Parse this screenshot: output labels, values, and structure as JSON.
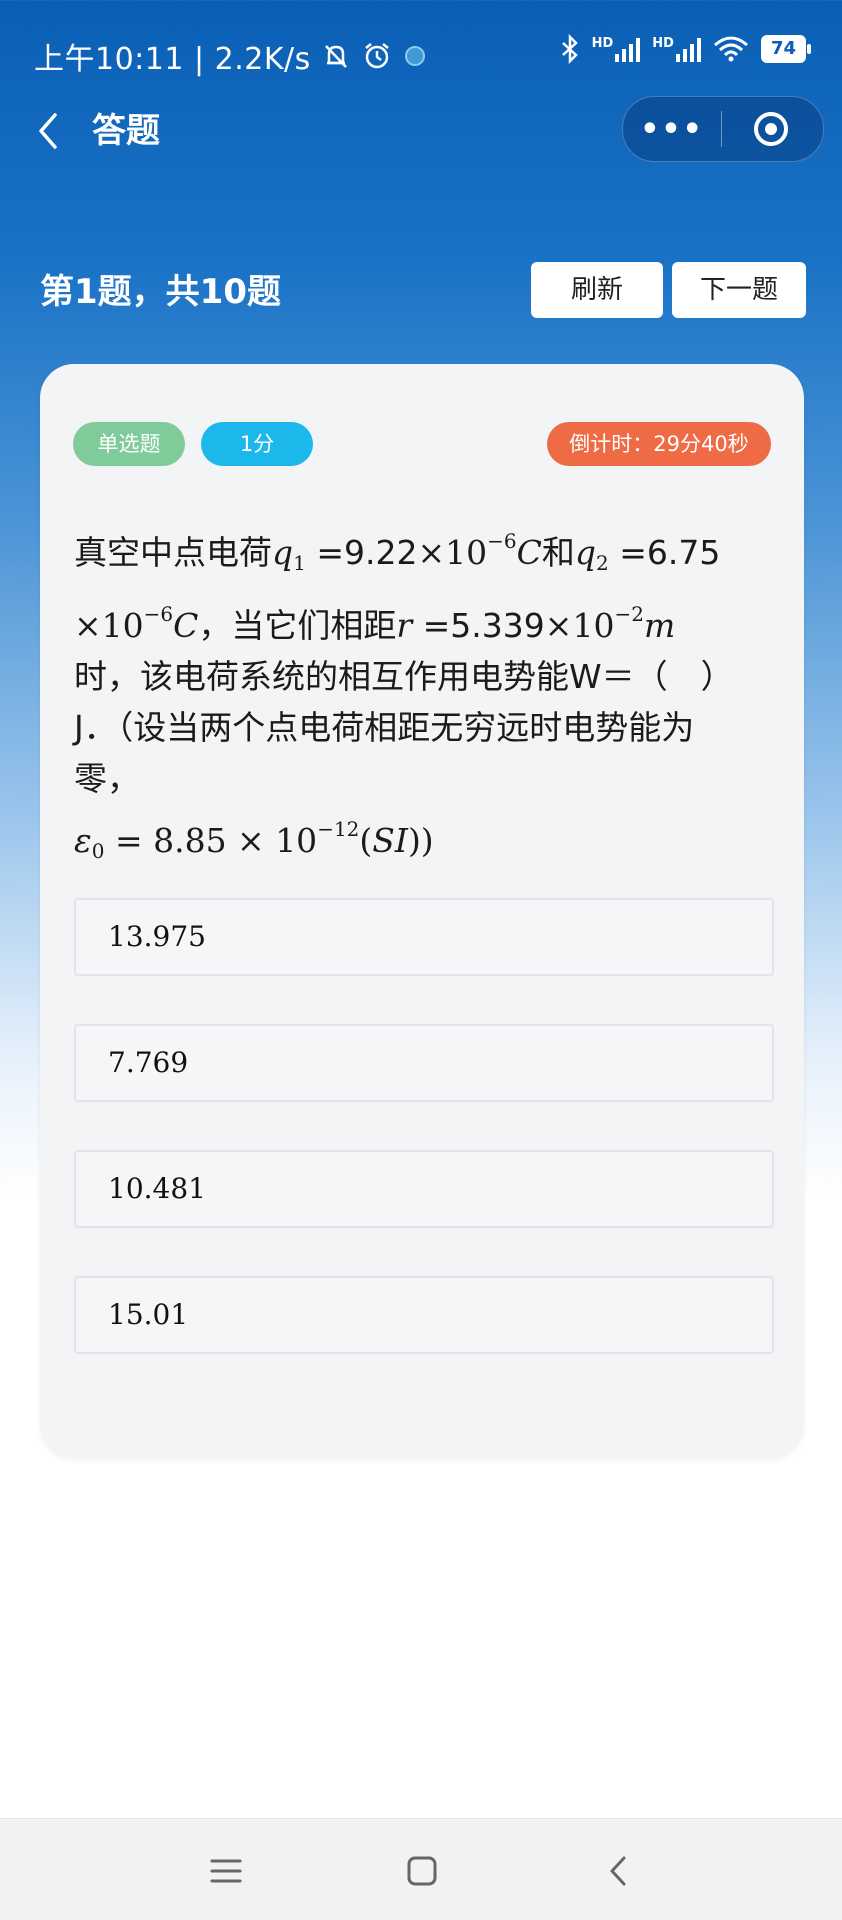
{
  "status_bar": {
    "time_speed": "上午10:11 | 2.2K/s",
    "battery": "74",
    "hd1": "HD",
    "hd2": "HD"
  },
  "nav": {
    "title": "答题",
    "more": "•••"
  },
  "quiz": {
    "progress": "第1题，共10题",
    "refresh_label": "刷新",
    "next_label": "下一题"
  },
  "question": {
    "type_tag": "单选题",
    "score_tag": "1分",
    "countdown": "倒计时：29分40秒",
    "text": {
      "l1_a": "真空中点电荷",
      "q1": "q",
      "q1_sub": "1",
      "l1_b": " =9.22",
      "times": "×",
      "ten": "10",
      "exp_neg6": "−6",
      "C": "C",
      "l1_c": "和",
      "q2": "q",
      "q2_sub": "2",
      "l1_d": " =6.75",
      "l2_b": "，当它们相距",
      "r": "r",
      "l2_c": " =5.339",
      "exp_neg2": "−2",
      "m": "m",
      "l3": "时，该电荷系统的相互作用电势能W＝（　）",
      "l4": "J．（设当两个点电荷相距无穷远时电势能为",
      "l5": "零，",
      "eps": "ε",
      "eps_sub": "0",
      "l6_a": " = 8.85 × 10",
      "exp_neg12": "−12",
      "l6_b": "(",
      "SI": "SI",
      "l6_c": "))"
    },
    "options": [
      "13.975",
      "7.769",
      "10.481",
      "15.01"
    ]
  },
  "colors": {
    "type_tag": "#7fcb9a",
    "score_tag": "#1cb8ec",
    "countdown_tag": "#ef6b45",
    "header_blue": "#0a5fb5"
  },
  "icons": {
    "back": "chevron-left-icon",
    "more": "more-dots-icon",
    "target": "target-icon",
    "menu": "menu-icon",
    "home": "home-square-icon",
    "sys_back": "back-icon"
  }
}
